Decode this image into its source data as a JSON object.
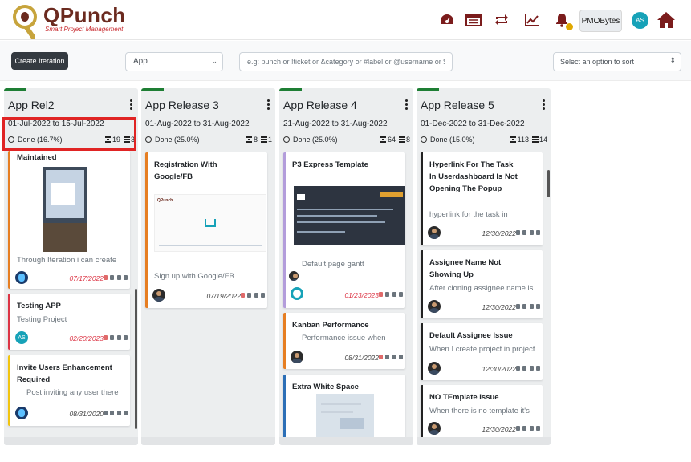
{
  "app": {
    "title": "QPunch",
    "subtitle": "Smart Project Management"
  },
  "header": {
    "icons": [
      "dashboard-icon",
      "table-icon",
      "sync-icon",
      "chart-line-icon",
      "bell-icon",
      "home-icon"
    ],
    "user_button": "PMOBytes",
    "avatar_initials": "AS",
    "accent_color": "#7b1c1c"
  },
  "toolbar": {
    "create_label": "Create Iteration",
    "project_select": "App",
    "search_placeholder": "e.g: punch or !ticket or &category or #label or @username or $priority",
    "sort_placeholder": "Select an option to sort"
  },
  "columns": [
    {
      "title": "App Rel2",
      "dates": "01-Jul-2022 to 15-Jul-2022",
      "done": "Done (16.7%)",
      "hours": "19",
      "count": "3",
      "cards": [
        {
          "title": "Maintained",
          "desc": "Through Iteration i can create",
          "date": "07/17/2022",
          "late": true,
          "color": "#e67e22"
        },
        {
          "title": "Testing APP",
          "desc": "Testing Project",
          "date": "02/20/2023",
          "late": true,
          "color": "#dc3545",
          "avatar": "AS"
        },
        {
          "title": "Invite Users Enhancement Required",
          "bullet": "Post inviting any user there",
          "date": "08/31/2020",
          "late": false,
          "color": "#f1c40f"
        }
      ]
    },
    {
      "title": "App Release 3",
      "dates": "01-Aug-2022 to 31-Aug-2022",
      "done": "Done (25.0%)",
      "hours": "8",
      "count": "1",
      "cards": [
        {
          "title": "Registration With Google/FB",
          "desc": "Sign up with Google/FB",
          "date": "07/19/2022",
          "late": false,
          "color": "#e67e22"
        }
      ]
    },
    {
      "title": "App Release 4",
      "dates": "21-Aug-2022 to 31-Aug-2022",
      "done": "Done (25.0%)",
      "hours": "64",
      "count": "8",
      "cards": [
        {
          "title": "P3 Express Template",
          "bullet": "Default page gantt",
          "date": "01/23/2023",
          "late": true,
          "color": "#b39ddb"
        },
        {
          "title": "Kanban Performance",
          "bullet": "Performance issue when",
          "date": "08/31/2022",
          "late": false,
          "color": "#e67e22"
        },
        {
          "title": "Extra White Space",
          "color": "#2c6fb7"
        }
      ]
    },
    {
      "title": "App Release 5",
      "dates": "01-Dec-2022 to 31-Dec-2022",
      "done": "Done (15.0%)",
      "hours": "113",
      "count": "14",
      "cards": [
        {
          "title": "Hyperlink For The Task In Userdashboard Is Not Opening The Popup",
          "desc": "hyperlink for the task in",
          "date": "12/30/2022",
          "late": false,
          "color": "#222222"
        },
        {
          "title": "Assignee Name Not Showing Up",
          "desc": "After cloning assignee name is",
          "date": "12/30/2022",
          "late": false,
          "color": "#222222"
        },
        {
          "title": "Default Assignee Issue",
          "desc": "When I create project in project",
          "date": "12/30/2022",
          "late": false,
          "color": "#222222"
        },
        {
          "title": "NO TEmplate Issue",
          "desc": "When there is no template it's",
          "date": "12/30/2022",
          "late": false,
          "color": "#222222"
        }
      ]
    }
  ],
  "card_image_caption": "QPunch"
}
